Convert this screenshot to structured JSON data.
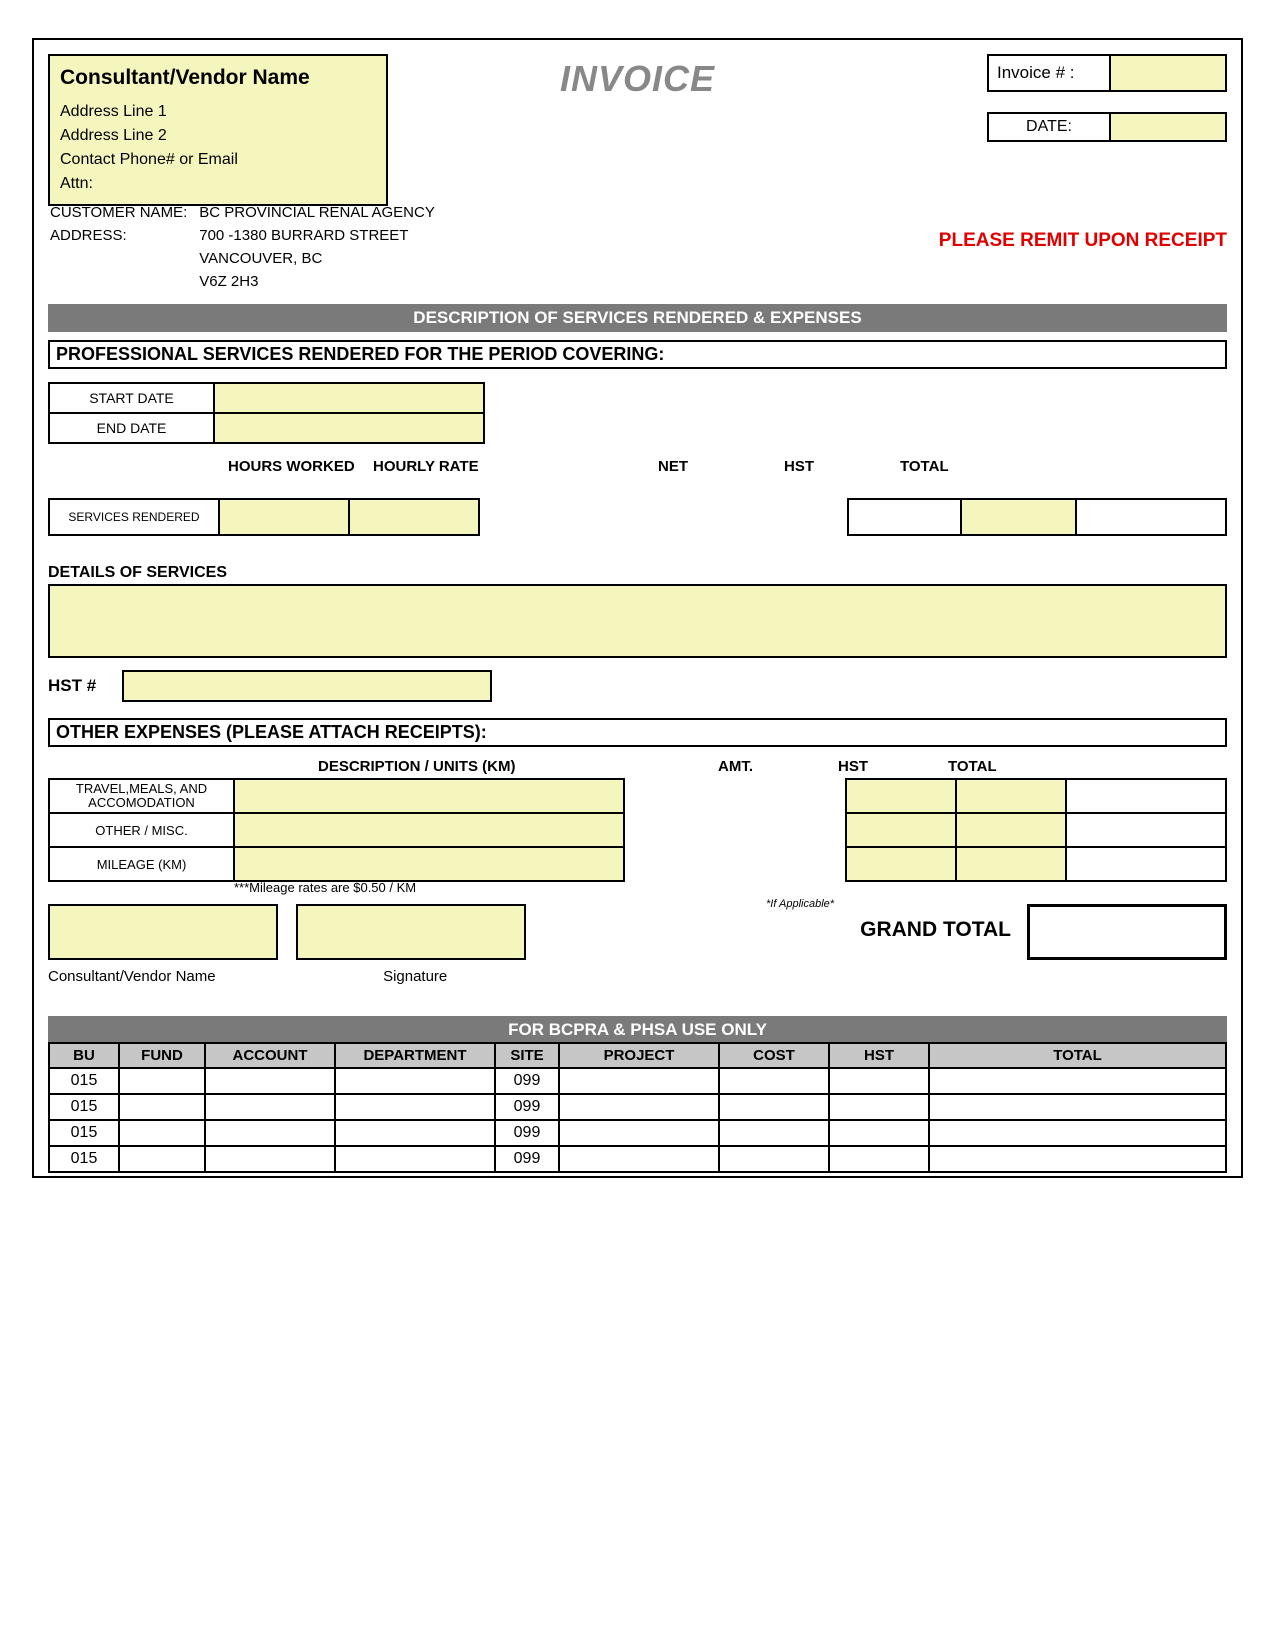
{
  "doc_title": "INVOICE",
  "vendor_box": {
    "title": "Consultant/Vendor Name",
    "addr1": "Address Line 1",
    "addr2": "Address Line 2",
    "contact": "Contact Phone# or Email",
    "attn": "Attn:"
  },
  "invoice_no_label": "Invoice # :",
  "invoice_no": "",
  "date_label": "DATE:",
  "date": "",
  "customer": {
    "name_label": "CUSTOMER NAME:",
    "addr_label": "ADDRESS:",
    "name": "BC PROVINCIAL RENAL AGENCY",
    "line1": "700 -1380 BURRARD STREET",
    "line2": "VANCOUVER, BC",
    "line3": "V6Z 2H3"
  },
  "remit": "PLEASE REMIT UPON RECEIPT",
  "desc_bar": "DESCRIPTION OF SERVICES RENDERED & EXPENSES",
  "prof_header": "PROFESSIONAL SERVICES RENDERED FOR THE PERIOD COVERING:",
  "dates": {
    "start_label": "START DATE",
    "start": "",
    "end_label": "END DATE",
    "end": ""
  },
  "svc_headers": {
    "hours": "HOURS WORKED",
    "rate": "HOURLY RATE",
    "net": "NET",
    "hst": "HST",
    "hst_note": "*If Applicable*",
    "total": "TOTAL"
  },
  "svc": {
    "label": "SERVICES RENDERED",
    "hours": "",
    "rate": "",
    "net": "",
    "hst": "",
    "total": ""
  },
  "details_label": "DETAILS OF SERVICES",
  "details": "",
  "hst_num_label": "HST #",
  "hst_num": "",
  "other_header": "OTHER EXPENSES (PLEASE ATTACH RECEIPTS):",
  "exp_headers": {
    "desc": "DESCRIPTION / UNITS (KM)",
    "amt": "AMT.",
    "hst": "HST",
    "total": "TOTAL"
  },
  "exp": {
    "travel_label": "TRAVEL,MEALS, AND ACCOMODATION",
    "other_label": "OTHER / MISC.",
    "mileage_label": "MILEAGE (KM)",
    "travel": {
      "desc": "",
      "amt": "",
      "hst": "",
      "total": ""
    },
    "other": {
      "desc": "",
      "amt": "",
      "hst": "",
      "total": ""
    },
    "mileage": {
      "desc": "",
      "amt": "",
      "hst": "",
      "total": ""
    }
  },
  "mileage_note": "***Mileage rates are $0.50 / KM",
  "sig": {
    "name_label": "Consultant/Vendor Name",
    "sig_label": "Signature"
  },
  "grand_label": "GRAND TOTAL",
  "grand_total": "",
  "use_only_bar": "FOR BCPRA & PHSA USE ONLY",
  "use_headers": [
    "BU",
    "FUND",
    "ACCOUNT",
    "DEPARTMENT",
    "SITE",
    "PROJECT",
    "COST",
    "HST",
    "TOTAL"
  ],
  "use_rows": [
    {
      "bu": "015",
      "fund": "",
      "account": "",
      "dept": "",
      "site": "099",
      "project": "",
      "cost": "",
      "hst": "",
      "total": ""
    },
    {
      "bu": "015",
      "fund": "",
      "account": "",
      "dept": "",
      "site": "099",
      "project": "",
      "cost": "",
      "hst": "",
      "total": ""
    },
    {
      "bu": "015",
      "fund": "",
      "account": "",
      "dept": "",
      "site": "099",
      "project": "",
      "cost": "",
      "hst": "",
      "total": ""
    },
    {
      "bu": "015",
      "fund": "",
      "account": "",
      "dept": "",
      "site": "099",
      "project": "",
      "cost": "",
      "hst": "",
      "total": ""
    }
  ]
}
